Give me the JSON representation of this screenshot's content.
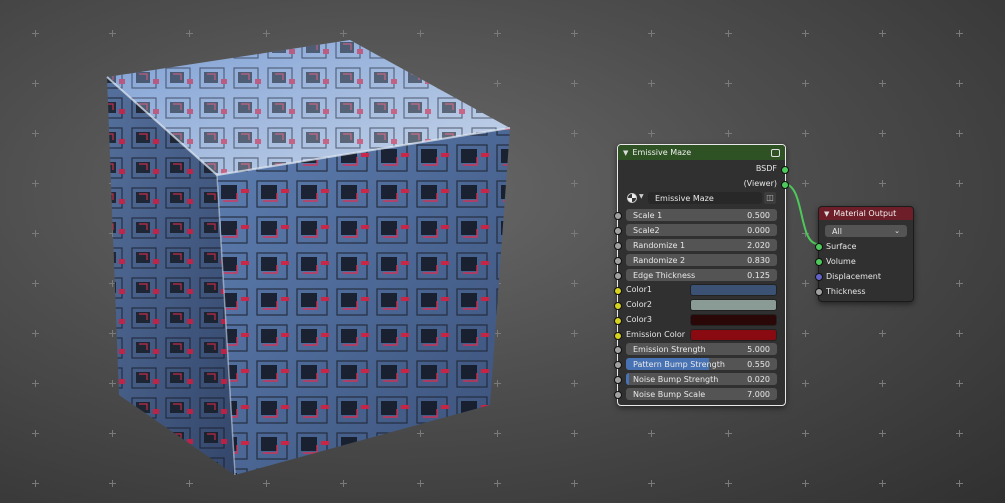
{
  "node_main": {
    "title": "Emissive Maze",
    "header_color": "#2f5224",
    "outputs": [
      "BSDF",
      "(Viewer)"
    ],
    "group_name": "Emissive Maze",
    "inputs": [
      {
        "label": "Scale 1",
        "value": "0.500"
      },
      {
        "label": "Scale2",
        "value": "0.000"
      },
      {
        "label": "Randomize 1",
        "value": "2.020"
      },
      {
        "label": "Randomize 2",
        "value": "0.830"
      },
      {
        "label": "Edge Thickness",
        "value": "0.125"
      }
    ],
    "colors": [
      {
        "label": "Color1",
        "swatch": "#3c5275"
      },
      {
        "label": "Color2",
        "swatch": "#8a9a94"
      },
      {
        "label": "Color3",
        "swatch": "#2a0808"
      },
      {
        "label": "Emission Color",
        "swatch": "#8a0a12"
      }
    ],
    "inputs2": [
      {
        "label": "Emission Strength",
        "value": "5.000",
        "fill": 0
      },
      {
        "label": "Pattern Bump Strength",
        "value": "0.550",
        "fill": 0.55
      },
      {
        "label": "Noise Bump Strength",
        "value": "0.020",
        "fill": 0.02
      },
      {
        "label": "Noise Bump Scale",
        "value": "7.000",
        "fill": 0
      }
    ]
  },
  "node_output": {
    "title": "Material Output",
    "header_color": "#6e1e28",
    "target": "All",
    "inputs": [
      "Surface",
      "Volume",
      "Displacement",
      "Thickness"
    ]
  },
  "colors": {
    "shader_socket": "#4ec85a",
    "color_socket": "#d6d21e",
    "float_socket": "#a1a1a1",
    "vector_socket": "#6363c7",
    "link": "#4ec85a"
  }
}
